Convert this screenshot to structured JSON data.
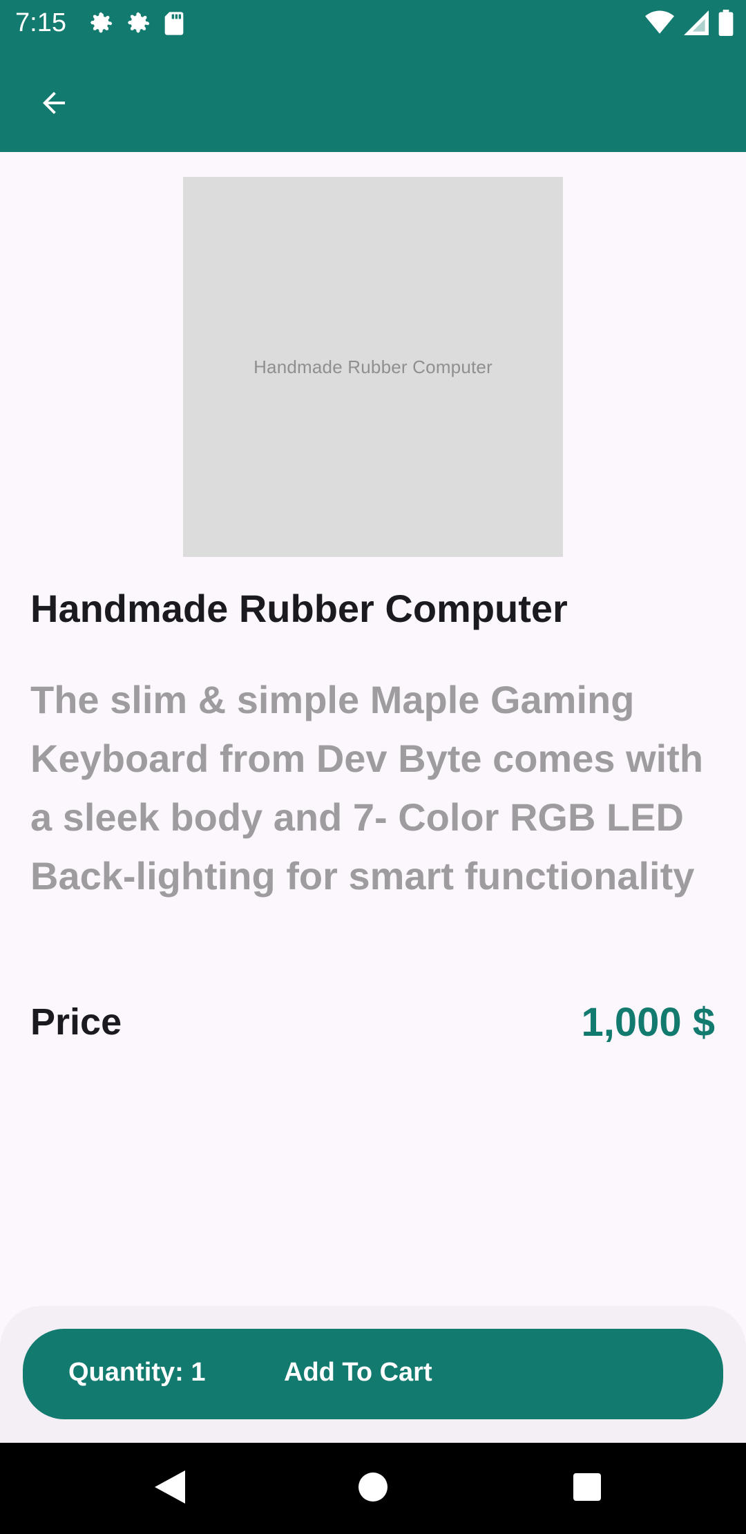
{
  "status_bar": {
    "time": "7:15",
    "icons_left": [
      "gear-icon",
      "gear-icon",
      "sd-card-icon"
    ],
    "icons_right": [
      "wifi-icon",
      "signal-icon",
      "battery-icon"
    ]
  },
  "app_bar": {
    "back_icon": "arrow-back-icon"
  },
  "product": {
    "image_alt": "Handmade Rubber Computer",
    "title": "Handmade Rubber Computer",
    "description": "The slim & simple Maple Gaming Keyboard from Dev Byte comes with a sleek body and 7- Color RGB LED Back-lighting for smart functionality",
    "price_label": "Price",
    "price_value": "1,000 $"
  },
  "cart": {
    "quantity_label": "Quantity: 1",
    "add_label": "Add To Cart"
  },
  "nav": {
    "back": "nav-back-icon",
    "home": "nav-home-icon",
    "recents": "nav-recents-icon"
  },
  "colors": {
    "primary": "#137a6f",
    "background": "#fcf7fd",
    "text_dark": "#1b1b1f",
    "text_muted": "#9e9c9f"
  }
}
